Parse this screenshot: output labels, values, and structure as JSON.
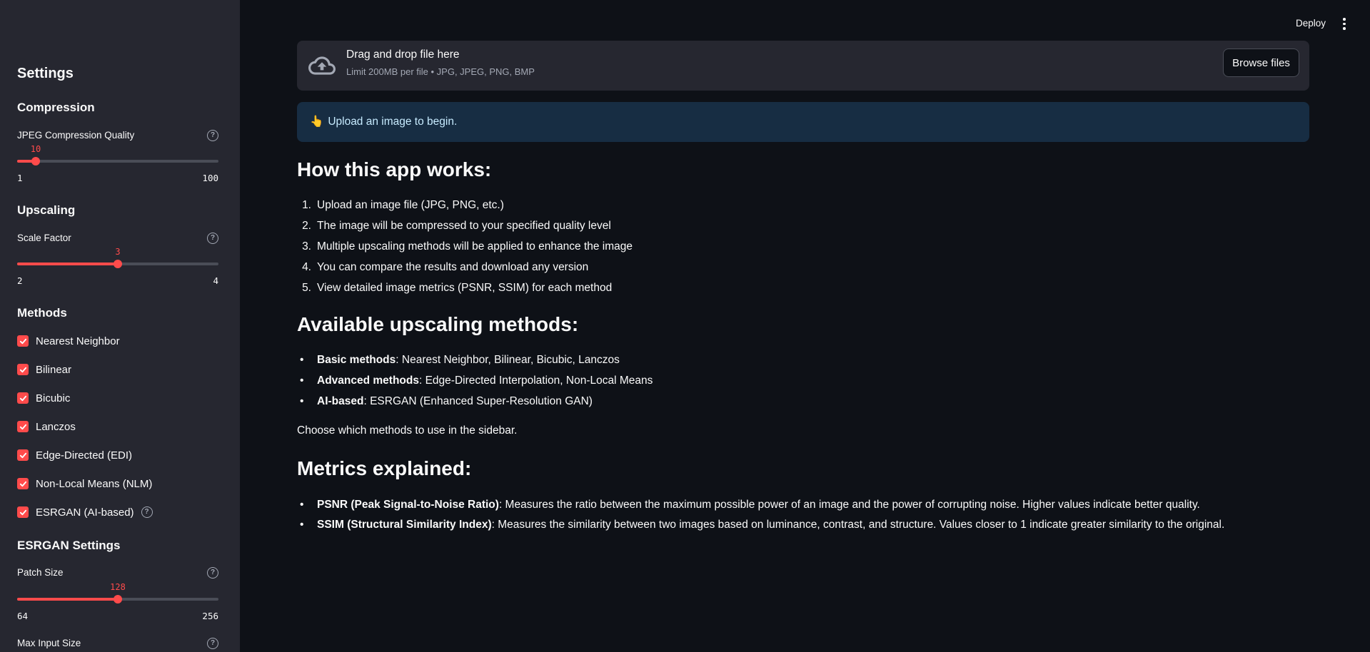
{
  "header": {
    "deploy_label": "Deploy"
  },
  "sidebar": {
    "title": "Settings",
    "compression": {
      "heading": "Compression",
      "quality_label": "JPEG Compression Quality",
      "quality_value": "10",
      "quality_min": "1",
      "quality_max": "100",
      "quality_fraction": 0.0909
    },
    "upscaling": {
      "heading": "Upscaling",
      "scale_label": "Scale Factor",
      "scale_value": "3",
      "scale_min": "2",
      "scale_max": "4",
      "scale_fraction": 0.5
    },
    "methods": {
      "heading": "Methods",
      "items": [
        {
          "label": "Nearest Neighbor",
          "checked": true
        },
        {
          "label": "Bilinear",
          "checked": true
        },
        {
          "label": "Bicubic",
          "checked": true
        },
        {
          "label": "Lanczos",
          "checked": true
        },
        {
          "label": "Edge-Directed (EDI)",
          "checked": true
        },
        {
          "label": "Non-Local Means (NLM)",
          "checked": true
        },
        {
          "label": "ESRGAN (AI-based)",
          "checked": true
        }
      ]
    },
    "esrgan": {
      "heading": "ESRGAN Settings",
      "patch_label": "Patch Size",
      "patch_value": "128",
      "patch_min": "64",
      "patch_max": "256",
      "patch_fraction": 0.5,
      "max_input_label": "Max Input Size"
    }
  },
  "uploader": {
    "title": "Drag and drop file here",
    "subtitle": "Limit 200MB per file • JPG, JPEG, PNG, BMP",
    "browse_label": "Browse files"
  },
  "info": {
    "emoji": "👆",
    "text": "Upload an image to begin."
  },
  "how": {
    "heading": "How this app works:",
    "steps": [
      "Upload an image file (JPG, PNG, etc.)",
      "The image will be compressed to your specified quality level",
      "Multiple upscaling methods will be applied to enhance the image",
      "You can compare the results and download any version",
      "View detailed image metrics (PSNR, SSIM) for each method"
    ]
  },
  "available": {
    "heading": "Available upscaling methods:",
    "items": [
      {
        "bold": "Basic methods",
        "rest": ": Nearest Neighbor, Bilinear, Bicubic, Lanczos"
      },
      {
        "bold": "Advanced methods",
        "rest": ": Edge-Directed Interpolation, Non-Local Means"
      },
      {
        "bold": "AI-based",
        "rest": ": ESRGAN (Enhanced Super-Resolution GAN)"
      }
    ],
    "footer": "Choose which methods to use in the sidebar."
  },
  "metrics": {
    "heading": "Metrics explained:",
    "items": [
      {
        "bold": "PSNR (Peak Signal-to-Noise Ratio)",
        "rest": ": Measures the ratio between the maximum possible power of an image and the power of corrupting noise. Higher values indicate better quality."
      },
      {
        "bold": "SSIM (Structural Similarity Index)",
        "rest": ": Measures the similarity between two images based on luminance, contrast, and structure. Values closer to 1 indicate greater similarity to the original."
      }
    ]
  },
  "colors": {
    "accent": "#ff4b4b",
    "sidebar_bg": "#262730",
    "main_bg": "#0e1117",
    "info_bg": "#172d43"
  },
  "icons": [
    "cloud-upload-icon",
    "help-icon",
    "check-icon",
    "kebab-menu-icon"
  ]
}
